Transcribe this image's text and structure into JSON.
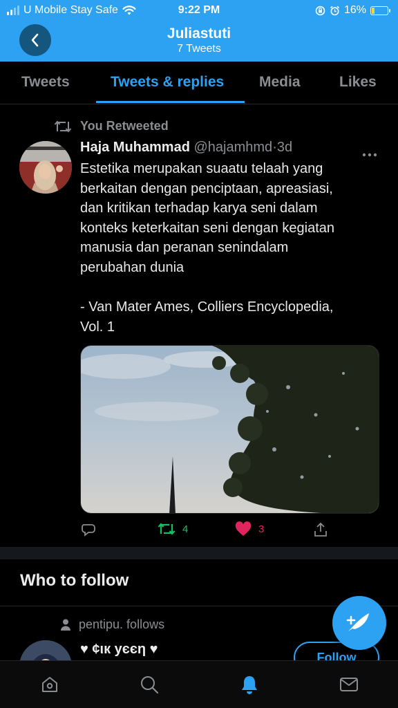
{
  "status": {
    "carrier": "U Mobile Stay Safe",
    "time": "9:22 PM",
    "battery": "16%",
    "battery_fraction": 0.16
  },
  "header": {
    "title": "Juliastuti",
    "subtitle": "7 Tweets",
    "back_icon": "chevron-left-icon",
    "color": "#2da1f2"
  },
  "tabs": [
    {
      "label": "Tweets",
      "active": false
    },
    {
      "label": "Tweets & replies",
      "active": true
    },
    {
      "label": "Media",
      "active": false
    },
    {
      "label": "Likes",
      "active": false
    }
  ],
  "tweet": {
    "retweet_label": "You Retweeted",
    "author_name": "Haja Muhammad",
    "author_handle": "@hajamhmd",
    "separator": "·",
    "age": "3d",
    "lines": [
      "Estetika merupakan suaatu telaah yang",
      "berkaitan dengan penciptaan, apreasiasi,",
      "dan kritikan terhadap karya seni dalam",
      "konteks keterkaitan seni dengan kegiatan",
      "manusia dan peranan senindalam",
      "perubahan dunia"
    ],
    "quote_lines": [
      "- Van Mater Ames, Colliers Encyclopedia,",
      "Vol. 1"
    ],
    "actions": {
      "retweets": "4",
      "likes": "3"
    }
  },
  "who_to_follow": {
    "title": "Who to follow",
    "follows_text": "pentipu. follows",
    "suggestion_name": "♥ ¢ιк уєєη ♥",
    "follow_label": "Follow"
  },
  "bottom_nav": [
    "home-icon",
    "search-icon",
    "notifications-icon",
    "messages-icon"
  ],
  "colors": {
    "accent": "#2da1f2",
    "retweet": "#17bf63",
    "like": "#e0245e",
    "background": "#000000"
  }
}
